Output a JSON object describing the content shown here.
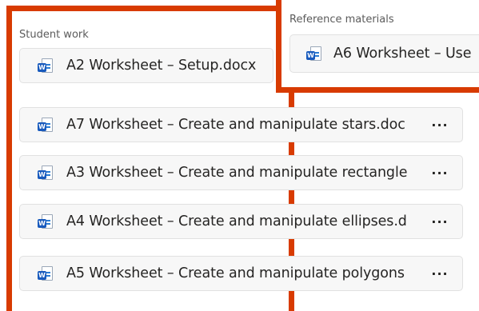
{
  "student_work": {
    "label": "Student work",
    "files": [
      {
        "name": "A2 Worksheet – Setup.docx",
        "has_more": false
      },
      {
        "name": "A7 Worksheet – Create and manipulate stars.doc",
        "has_more": true
      },
      {
        "name": "A3 Worksheet – Create and manipulate rectangle",
        "has_more": true
      },
      {
        "name": "A4 Worksheet – Create and manipulate ellipses.d",
        "has_more": true
      },
      {
        "name": "A5 Worksheet – Create and manipulate polygons",
        "has_more": true
      }
    ],
    "more_label": "···"
  },
  "reference_materials": {
    "label": "Reference materials",
    "files": [
      {
        "name": "A6 Worksheet – Use"
      }
    ]
  },
  "icons": {
    "file_icon": "word-document-icon",
    "more_icon": "more-options-icon"
  },
  "colors": {
    "highlight": "#d83b01",
    "word_blue": "#185abd",
    "card_bg": "#f7f7f7"
  }
}
